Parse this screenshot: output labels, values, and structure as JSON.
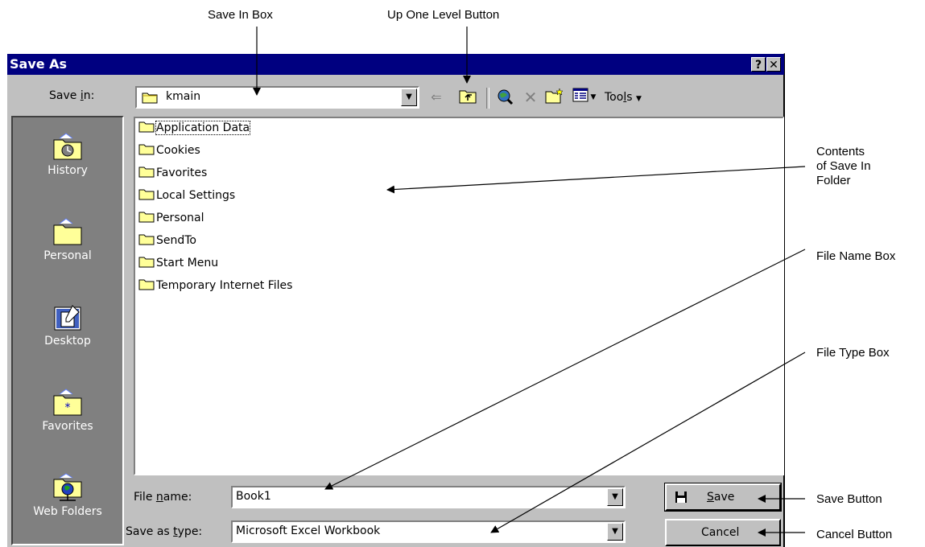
{
  "callouts": {
    "save_in_box": "Save In Box",
    "up_one_level": "Up One Level Button",
    "contents_line1": "Contents",
    "contents_line2": "of Save In",
    "contents_line3": "Folder",
    "file_name_box": "File Name Box",
    "file_type_box": "File Type Box",
    "save_button": "Save Button",
    "cancel_button": "Cancel Button"
  },
  "dialog": {
    "title": "Save As",
    "help_glyph": "?",
    "close_glyph": "✕"
  },
  "save_in": {
    "label_pre": "Save ",
    "label_key": "i",
    "label_post": "n:",
    "value": "kmain"
  },
  "toolbar": {
    "tools_label_pre": "Too",
    "tools_label_key": "l",
    "tools_label_post": "s"
  },
  "places": [
    {
      "label": "History",
      "icon": "history-icon"
    },
    {
      "label": "Personal",
      "icon": "personal-folder-icon"
    },
    {
      "label": "Desktop",
      "icon": "desktop-icon"
    },
    {
      "label": "Favorites",
      "icon": "favorites-icon"
    },
    {
      "label": "Web Folders",
      "icon": "web-folders-icon"
    }
  ],
  "files": [
    "Application Data",
    "Cookies",
    "Favorites",
    "Local Settings",
    "Personal",
    "SendTo",
    "Start Menu",
    "Temporary Internet Files"
  ],
  "file_name": {
    "label_pre": "File ",
    "label_key": "n",
    "label_post": "ame:",
    "value": "Book1"
  },
  "file_type": {
    "label_pre": "Save as ",
    "label_key": "t",
    "label_post": "ype:",
    "value": "Microsoft Excel Workbook"
  },
  "buttons": {
    "save_key": "S",
    "save_post": "ave",
    "cancel": "Cancel"
  },
  "colors": {
    "title_bar": "#000080",
    "dialog_face": "#c0c0c0",
    "places_bar": "#808080",
    "folder_yellow": "#ffff99"
  }
}
